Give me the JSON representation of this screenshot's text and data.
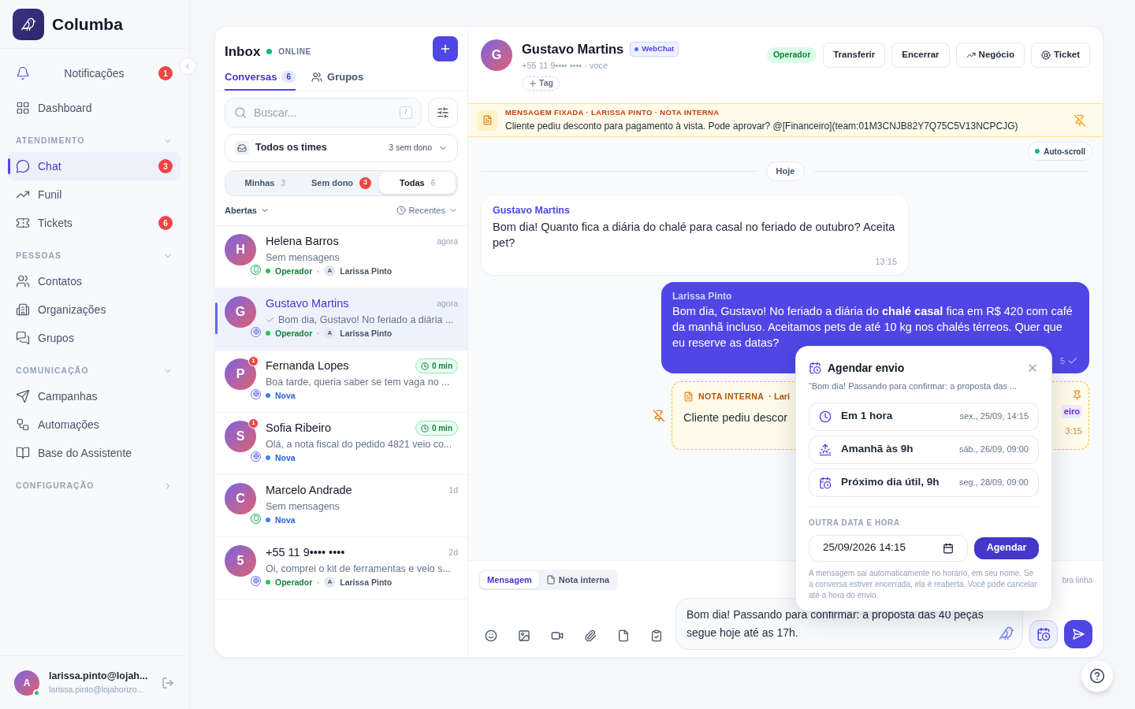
{
  "brand": {
    "name": "Columba"
  },
  "sidebar": {
    "top": [
      {
        "label": "Notificações",
        "badge": "1",
        "selected": false
      },
      {
        "label": "Dashboard",
        "selected": false
      }
    ],
    "sections": [
      {
        "title": "ATENDIMENTO",
        "expanded": true,
        "items": [
          {
            "label": "Chat",
            "badge": "3",
            "selected": true
          },
          {
            "label": "Funil",
            "selected": false
          },
          {
            "label": "Tickets",
            "badge": "6",
            "selected": false
          }
        ]
      },
      {
        "title": "PESSOAS",
        "expanded": true,
        "items": [
          {
            "label": "Contatos",
            "selected": false
          },
          {
            "label": "Organizações",
            "selected": false
          },
          {
            "label": "Grupos",
            "selected": false
          }
        ]
      },
      {
        "title": "COMUNICAÇÃO",
        "expanded": true,
        "items": [
          {
            "label": "Campanhas",
            "selected": false
          },
          {
            "label": "Automações",
            "selected": false
          },
          {
            "label": "Base do Assistente",
            "selected": false
          }
        ]
      },
      {
        "title": "CONFIGURAÇÃO",
        "expanded": false
      }
    ],
    "user": {
      "initial": "A",
      "name": "larissa.pinto@lojah...",
      "email": "larissa.pinto@lojahorizo...",
      "online": true
    }
  },
  "inbox": {
    "title": "Inbox",
    "status": "ONLINE",
    "online": true,
    "tabs": [
      {
        "label": "Conversas",
        "count": "6",
        "selected": true
      },
      {
        "label": "Grupos",
        "selected": false
      }
    ],
    "search": {
      "placeholder": "Buscar...",
      "shortcut": "/"
    },
    "team": {
      "label": "Todos os times",
      "info": "3 sem dono"
    },
    "filters": [
      {
        "label": "Minhas",
        "count": "3",
        "alert": false,
        "selected": false
      },
      {
        "label": "Sem dono",
        "count": "3",
        "alert": true,
        "selected": false
      },
      {
        "label": "Todas",
        "count": "6",
        "alert": false,
        "selected": true
      }
    ],
    "status_filter": "Abertas",
    "sort": "Recentes",
    "conversations": [
      {
        "initial": "H",
        "name": "Helena Barros",
        "time": "agora",
        "preview": "Sem mensagens",
        "sent": false,
        "kind": "mobile",
        "status": "Operador",
        "color": "#22c55e",
        "agent": "Larissa Pinto",
        "agent_initial": "A",
        "selected": false
      },
      {
        "initial": "G",
        "name": "Gustavo Martins",
        "time": "agora",
        "preview": "Bom dia, Gustavo! No feriado a diária ...",
        "sent": true,
        "kind": "web",
        "status": "Operador",
        "color": "#22c55e",
        "agent": "Larissa Pinto",
        "agent_initial": "A",
        "selected": true
      },
      {
        "initial": "P",
        "name": "Fernanda Lopes",
        "waiting": "0 min",
        "unread": "1",
        "preview": "Boa tarde, queria saber se tem vaga no ...",
        "sent": false,
        "kind": "web",
        "status": "Nova",
        "color": "#3b82f6",
        "selected": false
      },
      {
        "initial": "S",
        "name": "Sofia Ribeiro",
        "waiting": "0 min",
        "unread": "1",
        "preview": "Olá, a nota fiscal do pedido 4821 veio co...",
        "sent": false,
        "kind": "web",
        "status": "Nova",
        "color": "#3b82f6",
        "selected": false
      },
      {
        "initial": "C",
        "name": "Marcelo Andrade",
        "time": "1d",
        "preview": "Sem mensagens",
        "sent": false,
        "kind": "mobile",
        "status": "Nova",
        "color": "#3b82f6",
        "selected": false
      },
      {
        "initial": "5",
        "name": "+55 11 9•••• ••••",
        "time": "2d",
        "preview": "Oi, comprei o kit de ferramentas e veio s...",
        "sent": false,
        "kind": "web",
        "status": "Operador",
        "color": "#22c55e",
        "agent": "Larissa Pinto",
        "agent_initial": "A",
        "selected": false
      }
    ]
  },
  "chat": {
    "contact": {
      "initial": "G",
      "name": "Gustavo Martins",
      "channel": "WebChat",
      "phone": "+55 11 9•••• •••• · voce",
      "tag_button": "Tag"
    },
    "status": "Operador",
    "actions": [
      {
        "label": "Transferir"
      },
      {
        "label": "Encerrar"
      },
      {
        "label": "Negócio"
      },
      {
        "label": "Ticket"
      }
    ],
    "pinned": {
      "title": "MENSAGEM FIXADA · LARISSA PINTO · NOTA INTERNA",
      "text": "Cliente pediu desconto para pagamento à vista. Pode aprovar? @[Financeiro](team:01M3CNJB82Y7Q75C5V13NCPCJG)"
    },
    "auto_scroll": {
      "label": "Auto-scroll",
      "on": true
    },
    "day": "Hoje",
    "messages": [
      {
        "kind": "incoming",
        "author": "Gustavo Martins",
        "text": "Bom dia! Quanto fica a diária do chalé para casal no feriado de outubro? Aceita pet?",
        "time": "13:15"
      },
      {
        "kind": "outgoing",
        "author": "Larissa Pinto",
        "text": "Bom dia, Gustavo! No feriado a diária do **chalé casal** fica em R$ 420 com café da manhã incluso. Aceitamos pets de até 10 kg nos chalés térreos. Quer que eu reserve as datas?",
        "time": "5",
        "read": true
      },
      {
        "kind": "note",
        "label": "NOTA INTERNA",
        "author": "· Lari",
        "text": "Cliente pediu descor",
        "mention": "eiro",
        "time": "3:15",
        "pinned": true
      }
    ],
    "composer": {
      "modes": [
        {
          "label": "Mensagem",
          "selected": true
        },
        {
          "label": "Nota interna",
          "selected": false
        }
      ],
      "hint": "bra linha",
      "text": "Bom dia! Passando para confirmar: a proposta das 40 peças segue hoje até as 17h.",
      "schedule_active": true
    },
    "schedule": {
      "title": "Agendar envio",
      "preview": "“Bom dia! Passando para confirmar: a proposta das ...",
      "options": [
        {
          "label": "Em 1 hora",
          "date": "sex., 25/09, 14:15"
        },
        {
          "label": "Amanhã às 9h",
          "date": "sáb., 26/09, 09:00"
        },
        {
          "label": "Próximo dia útil, 9h",
          "date": "seg., 28/09, 09:00"
        }
      ],
      "custom_label": "OUTRA DATA E HORA",
      "datetime": "25/09/2026 14:15",
      "submit": "Agendar",
      "note": "A mensagem sai automaticamente no horário, em seu nome. Se a conversa estiver encerrada, ela é reaberta. Você pode cancelar até a hora do envio."
    }
  }
}
